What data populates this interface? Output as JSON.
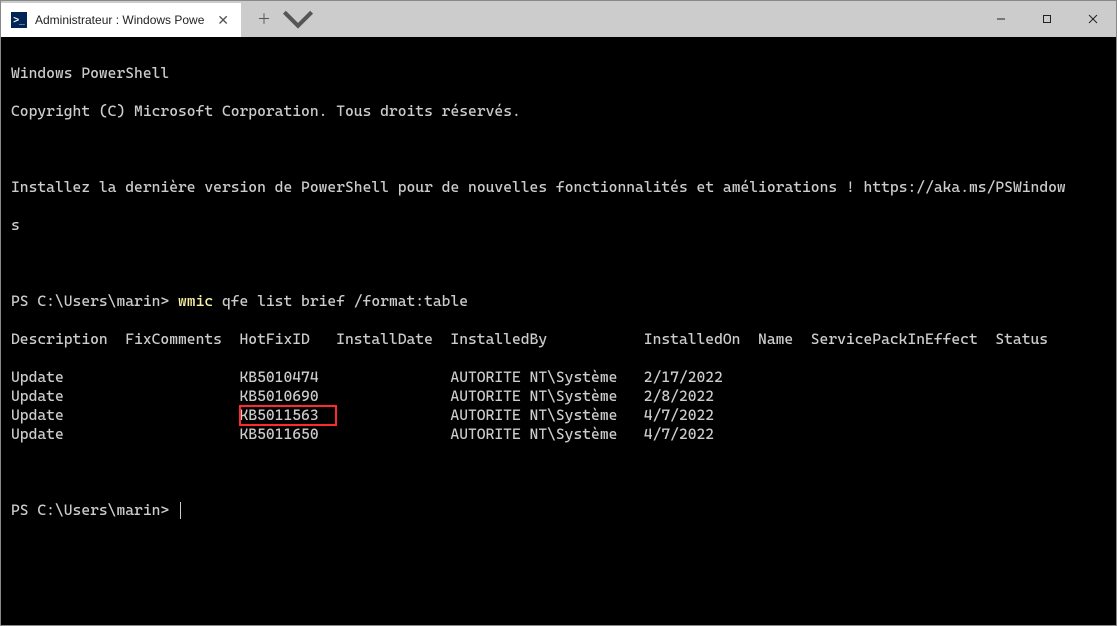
{
  "tab": {
    "title": "Administrateur : Windows Powe",
    "icon_label": ">_"
  },
  "banner": {
    "line1": "Windows PowerShell",
    "line2": "Copyright (C) Microsoft Corporation. Tous droits réservés.",
    "line3a": "Installez la dernière version de PowerShell pour de nouvelles fonctionnalités et améliorations ! https://aka.ms/PSWindow",
    "line3b": "s"
  },
  "prompt1": {
    "text": "PS C:\\Users\\marin> ",
    "cmd_part1": "wmic",
    "cmd_part2": " qfe list brief /format:table"
  },
  "headers": {
    "description": "Description",
    "fixcomments": "FixComments",
    "hotfixid": "HotFixID",
    "installdate": "InstallDate",
    "installedby": "InstalledBy",
    "installedon": "InstalledOn",
    "name": "Name",
    "servicepack": "ServicePackInEffect",
    "status": "Status"
  },
  "rows": [
    {
      "description": "Update",
      "hotfixid": "KB5010474",
      "installedby": "AUTORITE NT\\Système",
      "installedon": "2/17/2022",
      "highlight": false
    },
    {
      "description": "Update",
      "hotfixid": "KB5010690",
      "installedby": "AUTORITE NT\\Système",
      "installedon": "2/8/2022",
      "highlight": false
    },
    {
      "description": "Update",
      "hotfixid": "KB5011563",
      "installedby": "AUTORITE NT\\Système",
      "installedon": "4/7/2022",
      "highlight": true
    },
    {
      "description": "Update",
      "hotfixid": "KB5011650",
      "installedby": "AUTORITE NT\\Système",
      "installedon": "4/7/2022",
      "highlight": false
    }
  ],
  "prompt2": {
    "text": "PS C:\\Users\\marin> "
  }
}
